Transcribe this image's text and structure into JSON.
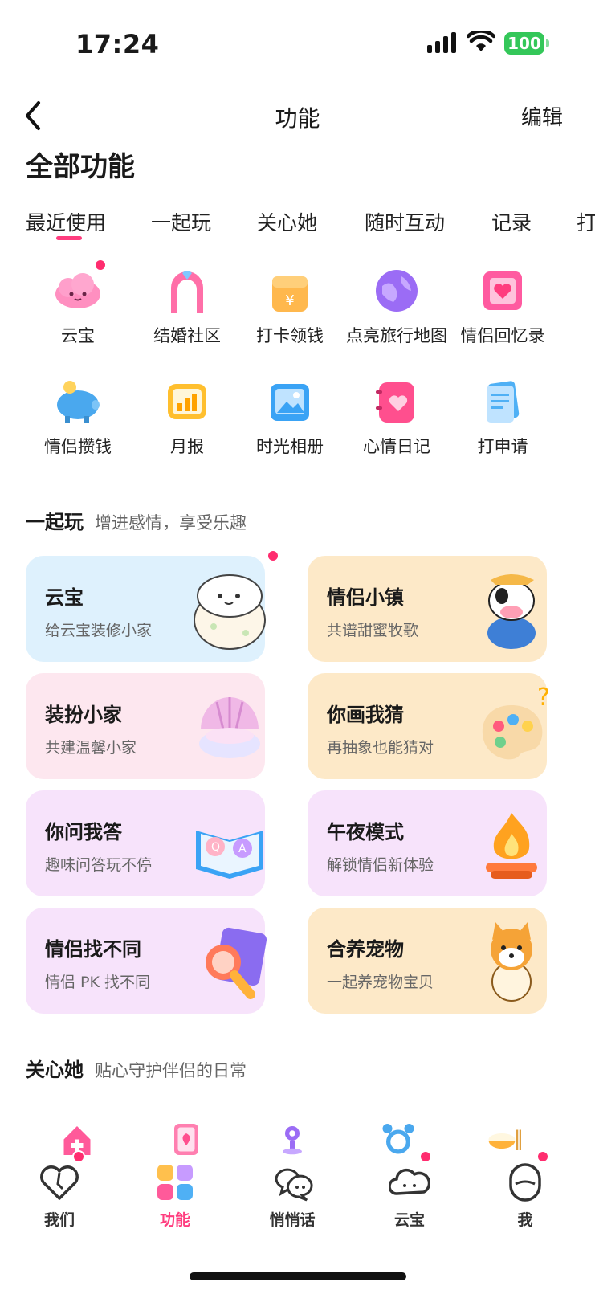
{
  "status": {
    "time": "17:24",
    "battery": "100"
  },
  "nav": {
    "title": "功能",
    "edit": "编辑"
  },
  "page_title": "全部功能",
  "tabs": [
    "最近使用",
    "一起玩",
    "关心她",
    "随时互动",
    "记录",
    "打"
  ],
  "recent": [
    {
      "label": "云宝",
      "icon": "cloud-mascot-icon"
    },
    {
      "label": "结婚社区",
      "icon": "wedding-arch-icon"
    },
    {
      "label": "打卡领钱",
      "icon": "coin-box-icon"
    },
    {
      "label": "点亮旅行地图",
      "icon": "globe-icon"
    },
    {
      "label": "情侣回忆录",
      "icon": "heart-film-icon"
    },
    {
      "label": "情侣攒钱",
      "icon": "piggy-bank-icon"
    },
    {
      "label": "月报",
      "icon": "report-chart-icon"
    },
    {
      "label": "时光相册",
      "icon": "photo-album-icon"
    },
    {
      "label": "心情日记",
      "icon": "heart-diary-icon"
    },
    {
      "label": "打申请",
      "icon": "document-icon"
    }
  ],
  "play": {
    "title": "一起玩",
    "subtitle": "增进感情，享受乐趣",
    "cards": [
      {
        "title": "云宝",
        "sub": "给云宝装修小家",
        "color": "#def1fd",
        "art": "cloud-egg-art"
      },
      {
        "title": "情侣小镇",
        "sub": "共谱甜蜜牧歌",
        "color": "#fde9c8",
        "art": "cow-farmer-art"
      },
      {
        "title": "装扮小家",
        "sub": "共建温馨小家",
        "color": "#fde7ef",
        "art": "shell-bed-art"
      },
      {
        "title": "你画我猜",
        "sub": "再抽象也能猜对",
        "color": "#fde9c8",
        "art": "palette-art"
      },
      {
        "title": "你问我答",
        "sub": "趣味问答玩不停",
        "color": "#f7e3fb",
        "art": "qa-book-art"
      },
      {
        "title": "午夜模式",
        "sub": "解锁情侣新体验",
        "color": "#f7e3fb",
        "art": "campfire-art"
      },
      {
        "title": "情侣找不同",
        "sub": "情侣 PK 找不同",
        "color": "#f7e3fb",
        "art": "magnifier-art"
      },
      {
        "title": "合养宠物",
        "sub": "一起养宠物宝贝",
        "color": "#fde9c8",
        "art": "shiba-dog-art"
      }
    ]
  },
  "care": {
    "title": "关心她",
    "subtitle": "贴心守护伴侣的日常"
  },
  "bottom_tabs": [
    {
      "label": "我们",
      "icon": "heart-outline-icon"
    },
    {
      "label": "功能",
      "icon": "grid-squares-icon"
    },
    {
      "label": "悄悄话",
      "icon": "chat-bubbles-icon"
    },
    {
      "label": "云宝",
      "icon": "cloud-outline-icon"
    },
    {
      "label": "我",
      "icon": "face-outline-icon"
    }
  ],
  "colors": {
    "accent": "#ff3d7f",
    "badge": "#ff2d6f"
  }
}
